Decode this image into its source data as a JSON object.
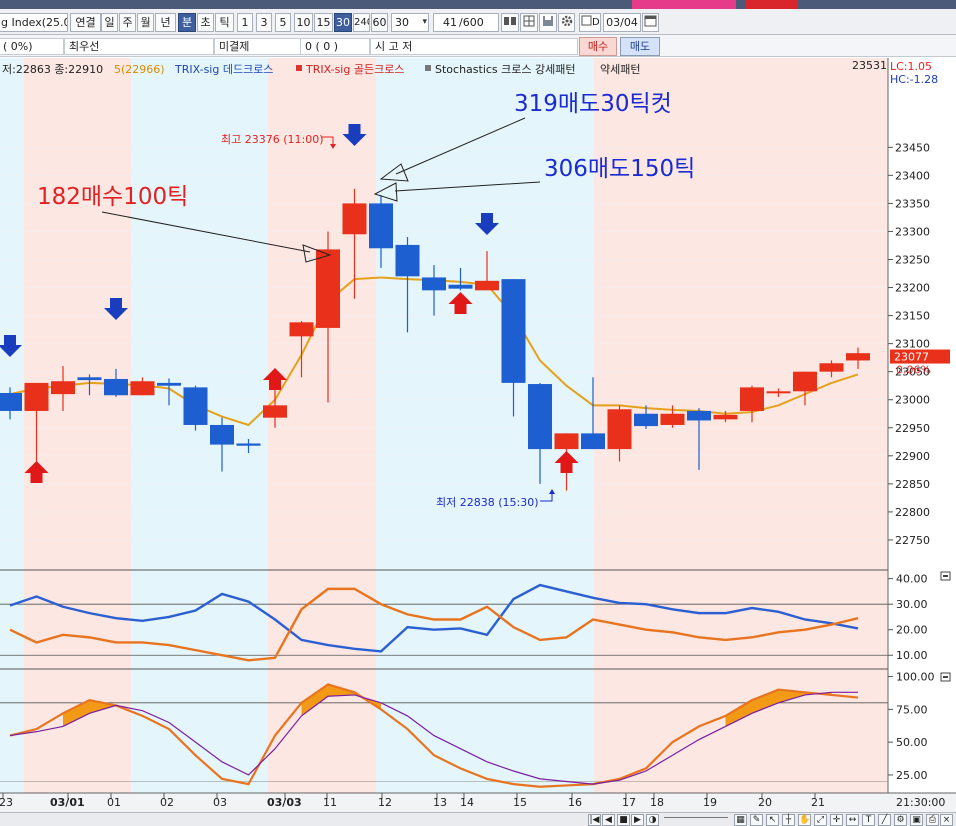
{
  "toolbar": {
    "symbol": "g Index(25.0",
    "buttons": [
      "연결",
      "일",
      "주",
      "월",
      "년",
      "분",
      "초",
      "틱",
      "1",
      "3",
      "5",
      "10",
      "15",
      "30",
      "240",
      "60"
    ],
    "selected": [
      "분",
      "30"
    ],
    "period_value": "30",
    "count_value": "41",
    "count_total": "/600",
    "date_value": "03/04"
  },
  "inforow": {
    "cell1": "(      0%)",
    "cell2": "최우선",
    "cell3": "미결제",
    "cell4": "0 (      0     )",
    "cell5": "시          고          저",
    "buy_label": "매수",
    "sell_label": "매도"
  },
  "chart_data": [
    {
      "type": "candlestick",
      "legend": [
        "저:22863 종:22910",
        "5(22966)",
        "TRIX-sig 데드크로스",
        "TRIX-sig 골든크로스",
        "Stochastics 크로스 강세패턴",
        "약세패턴"
      ],
      "y_ticks": [
        23450,
        23400,
        23350,
        23300,
        23250,
        23200,
        23150,
        23100,
        23050,
        23000,
        22950,
        22900,
        22850,
        22800,
        22750
      ],
      "ylim": [
        22700,
        23570
      ],
      "axis_top_label": "23531",
      "lc_label": "LC:1.05",
      "hc_label": "HC:-1.28",
      "current_price": "23077",
      "current_change": "0.06%",
      "candles": [
        {
          "o": 23012,
          "h": 23022,
          "l": 22965,
          "c": 22980
        },
        {
          "o": 22980,
          "h": 23028,
          "l": 22890,
          "c": 23030
        },
        {
          "o": 23010,
          "h": 23060,
          "l": 22980,
          "c": 23033
        },
        {
          "o": 23040,
          "h": 23045,
          "l": 23008,
          "c": 23035
        },
        {
          "o": 23037,
          "h": 23055,
          "l": 23005,
          "c": 23008
        },
        {
          "o": 23008,
          "h": 23040,
          "l": 23008,
          "c": 23033
        },
        {
          "o": 23030,
          "h": 23038,
          "l": 22990,
          "c": 23025
        },
        {
          "o": 23022,
          "h": 23025,
          "l": 22945,
          "c": 22955
        },
        {
          "o": 22955,
          "h": 22968,
          "l": 22872,
          "c": 22920
        },
        {
          "o": 22922,
          "h": 22930,
          "l": 22905,
          "c": 22918
        },
        {
          "o": 22968,
          "h": 23040,
          "l": 22950,
          "c": 22990
        },
        {
          "o": 23113,
          "h": 23140,
          "l": 23040,
          "c": 23138
        },
        {
          "o": 23128,
          "h": 23300,
          "l": 22995,
          "c": 23268
        },
        {
          "o": 23295,
          "h": 23376,
          "l": 23180,
          "c": 23350
        },
        {
          "o": 23350,
          "h": 23365,
          "l": 23235,
          "c": 23270
        },
        {
          "o": 23276,
          "h": 23290,
          "l": 23120,
          "c": 23220
        },
        {
          "o": 23218,
          "h": 23240,
          "l": 23150,
          "c": 23195
        },
        {
          "o": 23205,
          "h": 23235,
          "l": 23195,
          "c": 23198
        },
        {
          "o": 23195,
          "h": 23265,
          "l": 23200,
          "c": 23212
        },
        {
          "o": 23215,
          "h": 23215,
          "l": 22970,
          "c": 23030
        },
        {
          "o": 23028,
          "h": 23030,
          "l": 22850,
          "c": 22912
        },
        {
          "o": 22912,
          "h": 22940,
          "l": 22838,
          "c": 22940
        },
        {
          "o": 22940,
          "h": 23040,
          "l": 22912,
          "c": 22912
        },
        {
          "o": 22912,
          "h": 22990,
          "l": 22890,
          "c": 22983
        },
        {
          "o": 22975,
          "h": 22990,
          "l": 22948,
          "c": 22953
        },
        {
          "o": 22955,
          "h": 22990,
          "l": 22950,
          "c": 22975
        },
        {
          "o": 22980,
          "h": 22985,
          "l": 22875,
          "c": 22963
        },
        {
          "o": 22965,
          "h": 22980,
          "l": 22960,
          "c": 22973
        },
        {
          "o": 22980,
          "h": 23025,
          "l": 22960,
          "c": 23022
        },
        {
          "o": 23012,
          "h": 23020,
          "l": 23005,
          "c": 23015
        },
        {
          "o": 23015,
          "h": 23050,
          "l": 22990,
          "c": 23050
        },
        {
          "o": 23050,
          "h": 23070,
          "l": 23040,
          "c": 23065
        },
        {
          "o": 23070,
          "h": 23093,
          "l": 23055,
          "c": 23083
        }
      ],
      "ma": [
        23010,
        23020,
        23025,
        23030,
        23028,
        23026,
        23020,
        22990,
        22970,
        22955,
        23000,
        23080,
        23175,
        23215,
        23218,
        23215,
        23213,
        23210,
        23205,
        23150,
        23070,
        23025,
        22990,
        22990,
        22985,
        22982,
        22980,
        22975,
        22978,
        22990,
        23010,
        23030,
        23045
      ],
      "annotations": {
        "high_label": "최고 23376 (11:00)",
        "low_label": "최저 22838 (15:30)",
        "trade_buy": "182매수100틱",
        "trade_cut": "319매도30틱컷",
        "trade_sell": "306매도150틱"
      }
    },
    {
      "type": "line",
      "name": "oscillator",
      "y_ticks": [
        40,
        30,
        20,
        10
      ],
      "ylim": [
        5,
        43
      ],
      "series": [
        {
          "color": "#2b5fd2",
          "values": [
            29.5,
            33,
            29,
            26.5,
            24.5,
            23.5,
            25,
            27.5,
            34,
            31,
            24,
            16,
            14,
            12.5,
            11.5,
            21,
            20,
            20.5,
            18,
            32,
            37.5,
            35,
            32.5,
            30.5,
            30,
            28,
            26.5,
            26.5,
            28.5,
            27,
            24,
            22.5,
            20.5
          ]
        },
        {
          "color": "#e8741f",
          "values": [
            20,
            15,
            18,
            17,
            15,
            15,
            14,
            12,
            10,
            8,
            9,
            28,
            36,
            36,
            30,
            26,
            24,
            24,
            29,
            21,
            16,
            17,
            24,
            22,
            20,
            19,
            17,
            16,
            17,
            19,
            20,
            22,
            24.5
          ]
        }
      ],
      "ref_lines": [
        30,
        10
      ]
    },
    {
      "type": "line",
      "name": "stochastics",
      "y_ticks": [
        100,
        75,
        50,
        25
      ],
      "ylim": [
        12,
        105
      ],
      "series": [
        {
          "color": "#e8741f",
          "values": [
            55,
            60,
            72,
            82,
            78,
            70,
            60,
            40,
            22,
            18,
            55,
            80,
            94,
            88,
            75,
            60,
            40,
            30,
            22,
            18,
            16,
            17,
            18,
            22,
            30,
            50,
            62,
            70,
            82,
            90,
            88,
            86,
            84
          ]
        },
        {
          "color": "#7a1fa2",
          "values": [
            55,
            58,
            62,
            72,
            78,
            74,
            65,
            50,
            35,
            25,
            45,
            70,
            85,
            86,
            80,
            70,
            55,
            45,
            35,
            28,
            22,
            20,
            18,
            21,
            28,
            40,
            52,
            62,
            72,
            80,
            86,
            88,
            88
          ]
        }
      ],
      "ref_line": 80
    }
  ],
  "xaxis": {
    "labels": [
      "23",
      "03/01",
      "01",
      "02",
      "03",
      "03/03",
      "11",
      "12",
      "13",
      "14",
      "15",
      "16",
      "17",
      "18",
      "19",
      "20",
      "21"
    ],
    "bold": [
      "03/01",
      "03/03"
    ],
    "right_label": "21:30:00"
  },
  "colors": {
    "up": "#e8301a",
    "down": "#1d5fd0",
    "ma": "#e4a11b",
    "bg_pink": "#fde7e2",
    "bg_cyan": "#e4f6fb",
    "arrow_up": "#e01818",
    "arrow_down": "#1a3dbd",
    "anno_red": "#e22222",
    "anno_blue": "#1a2bd1"
  },
  "scrollbar": {
    "icons": [
      "first-icon",
      "prev-icon",
      "stop-icon",
      "next-icon",
      "zoom-icon",
      "grid-icon",
      "tool-icon",
      "arrow-icon",
      "axis-icon",
      "hand-icon",
      "expand-icon",
      "settings-icon",
      "close-icon"
    ]
  }
}
